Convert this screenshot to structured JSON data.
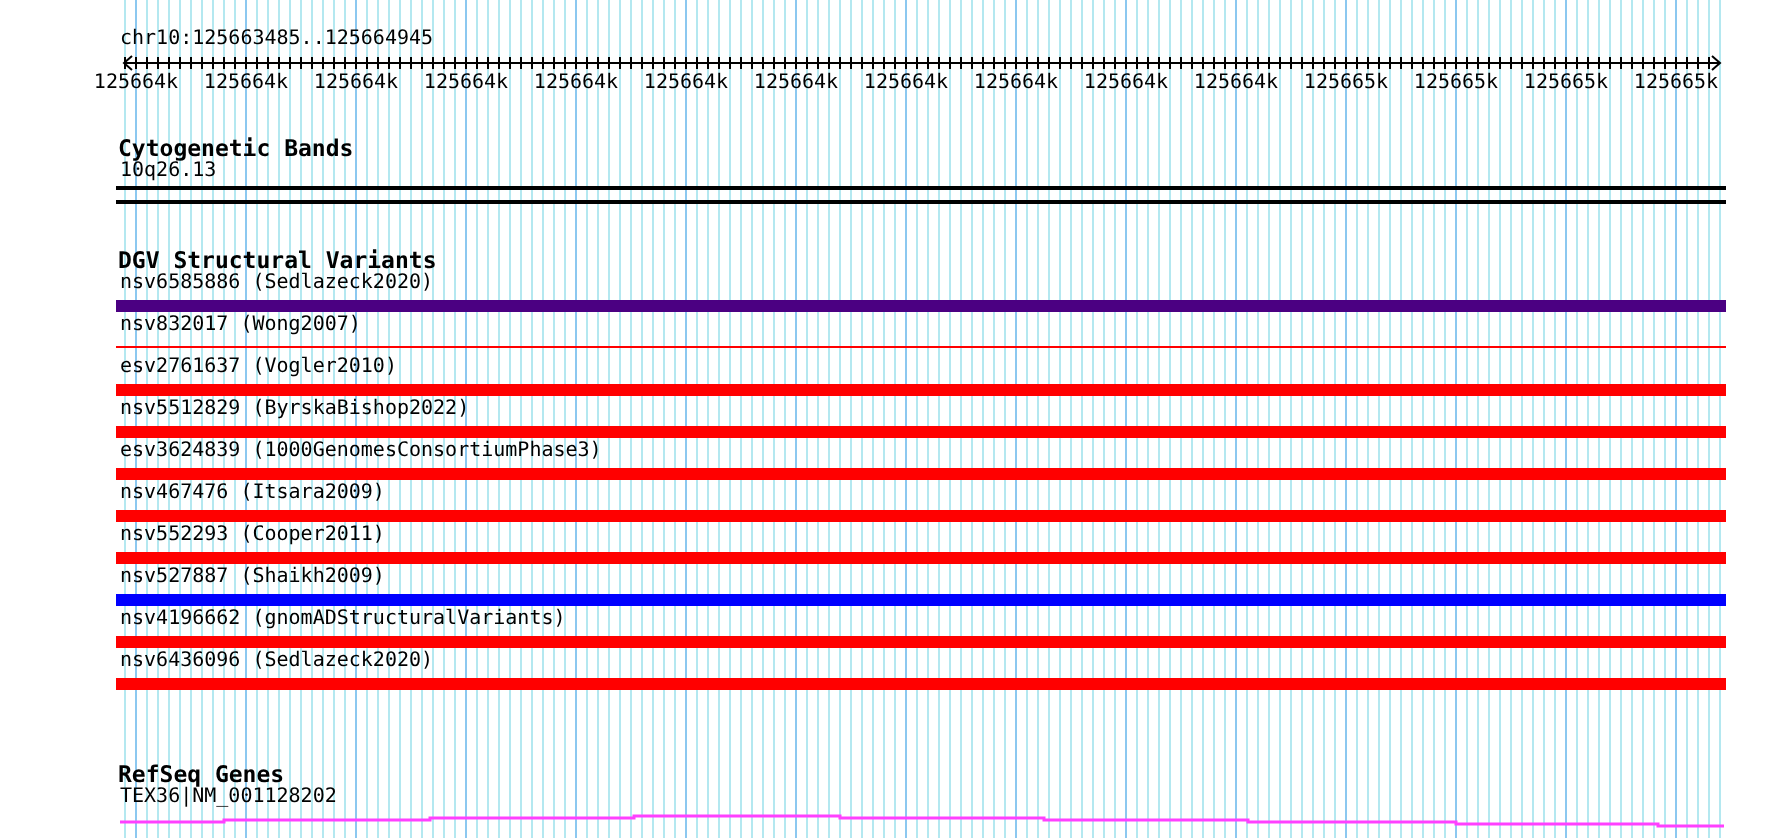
{
  "ruler": {
    "position": "chr10:125663485..125664945",
    "ticks": [
      "125664k",
      "125664k",
      "125664k",
      "125664k",
      "125664k",
      "125664k",
      "125664k",
      "125664k",
      "125664k",
      "125664k",
      "125664k",
      "125665k",
      "125665k",
      "125665k",
      "125665k"
    ]
  },
  "tracks": [
    {
      "kind": "cytoband",
      "title": "Cytogenetic Bands",
      "label": "10q26.13"
    },
    {
      "kind": "variants",
      "title": "DGV Structural Variants",
      "items": [
        {
          "label": "nsv6585886 (Sedlazeck2020)",
          "kind": "bar",
          "color": "#4b0082"
        },
        {
          "label": "nsv832017 (Wong2007)",
          "kind": "line",
          "color": "#ff0000"
        },
        {
          "label": "esv2761637 (Vogler2010)",
          "kind": "bar",
          "color": "#ff0000"
        },
        {
          "label": "nsv5512829 (ByrskaBishop2022)",
          "kind": "bar",
          "color": "#ff0000"
        },
        {
          "label": "esv3624839 (1000GenomesConsortiumPhase3)",
          "kind": "bar",
          "color": "#ff0000"
        },
        {
          "label": "nsv467476 (Itsara2009)",
          "kind": "bar",
          "color": "#ff0000"
        },
        {
          "label": "nsv552293 (Cooper2011)",
          "kind": "bar",
          "color": "#ff0000"
        },
        {
          "label": "nsv527887 (Shaikh2009)",
          "kind": "bar",
          "color": "#0000ff"
        },
        {
          "label": "nsv4196662 (gnomADStructuralVariants)",
          "kind": "bar",
          "color": "#ff0000"
        },
        {
          "label": "nsv6436096 (Sedlazeck2020)",
          "kind": "bar",
          "color": "#ff0000"
        }
      ]
    },
    {
      "kind": "gene",
      "title": "RefSeq Genes",
      "label": "TEX36|NM_001128202"
    }
  ]
}
